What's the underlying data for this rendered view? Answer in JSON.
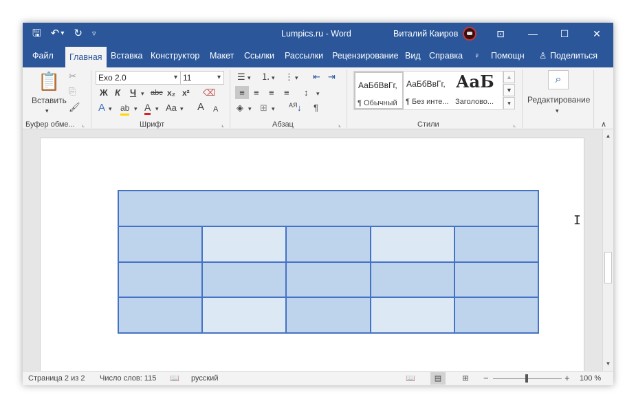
{
  "titlebar": {
    "title": "Lumpics.ru  -  Word",
    "user": "Виталий Каиров",
    "qat": {
      "save_icon": "🖫",
      "undo_icon": "↶",
      "undo_dropdown": "▾",
      "redo_icon": "↻",
      "customize_icon": "▿"
    },
    "controls": {
      "ribbon_display": "⊡",
      "minimize": "—",
      "maximize": "☐",
      "close": "✕"
    }
  },
  "tabs": {
    "file": "Файл",
    "home": "Главная",
    "insert": "Вставка",
    "design": "Конструктор",
    "layout": "Макет",
    "references": "Ссылки",
    "mailings": "Рассылки",
    "review": "Рецензирование",
    "view": "Вид",
    "help": "Справка",
    "tell_me": "Помощн",
    "share": "Поделиться",
    "tell_me_icon": "♀",
    "share_icon": "♙"
  },
  "ribbon": {
    "clipboard": {
      "paste_label": "Вставить",
      "paste_dropdown": "▾",
      "group_label": "Буфер обме...",
      "paste_icon": "📋",
      "cut_icon": "✂",
      "copy_icon": "⎘",
      "format_painter_icon": "🖌"
    },
    "font": {
      "font_name": "Exo 2.0",
      "font_size": "11",
      "group_label": "Шрифт",
      "bold": "Ж",
      "italic": "К",
      "underline": "Ч",
      "underline_dropdown": "▾",
      "strikethrough": "abc",
      "subscript": "x₂",
      "superscript": "x²",
      "clear_icon": "⌫",
      "text_effects": "A",
      "highlight": "ab",
      "font_color": "A",
      "change_case": "Aa",
      "grow": "A",
      "shrink": "A",
      "dropdown": "▾"
    },
    "paragraph": {
      "group_label": "Абзац",
      "bullets_icon": "☰",
      "numbering_icon": "⒈",
      "multilevel_icon": "⋮",
      "decrease_indent_icon": "⇤",
      "increase_indent_icon": "⇥",
      "align_left_icon": "≡",
      "center_icon": "≡",
      "align_right_icon": "≡",
      "justify_icon": "≡",
      "line_spacing_icon": "↕",
      "shading_icon": "◈",
      "borders_icon": "⊞",
      "sort_icon": "↓",
      "sort_letters": "АЯ",
      "pilcrow_icon": "¶",
      "dropdown": "▾"
    },
    "styles": {
      "group_label": "Стили",
      "items": [
        {
          "sample": "АаБбВвГг,",
          "name": "¶ Обычный"
        },
        {
          "sample": "АаБбВвГг,",
          "name": "¶ Без инте..."
        },
        {
          "sample": "АаБ",
          "name": "Заголово..."
        }
      ],
      "scroll_up": "▲",
      "scroll_down": "▼",
      "more": "▾"
    },
    "editing": {
      "label": "Редактирование",
      "dropdown": "▾",
      "search_icon": "⌕"
    },
    "collapse_icon": "∧",
    "launcher_icon": "⌞"
  },
  "document": {
    "table": {
      "columns": 5,
      "header_row": "merged",
      "body_rows": 3
    },
    "cursor_icon": "I"
  },
  "scrollbar": {
    "up": "▲",
    "down": "▼"
  },
  "statusbar": {
    "page": "Страница 2 из 2",
    "word_count": "Число слов: 115",
    "proofing_icon": "📖",
    "language": "русский",
    "read_mode_icon": "📖",
    "print_layout_icon": "▤",
    "web_layout_icon": "⊞",
    "zoom_out": "−",
    "zoom_in": "+",
    "zoom": "100 %",
    "zoom_level_percent": 100
  },
  "colors": {
    "accent": "#2b579a",
    "table_border": "#4472c4",
    "table_dark_cell": "#bed3ec",
    "table_light_cell": "#dde8f5"
  }
}
